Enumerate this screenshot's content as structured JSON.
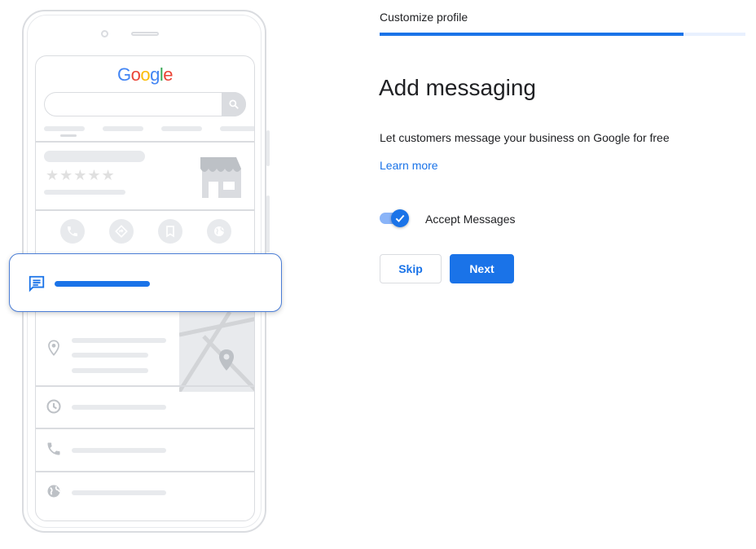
{
  "illustration": {
    "logo_letters": [
      "G",
      "o",
      "o",
      "g",
      "l",
      "e"
    ],
    "logo_colors": [
      "#4285f4",
      "#ea4335",
      "#fbbc05",
      "#4285f4",
      "#34a853",
      "#ea4335"
    ],
    "stars": "★★★★★"
  },
  "panel": {
    "step_title": "Customize profile",
    "progress_percent": 83,
    "heading": "Add messaging",
    "description": "Let customers message your business on Google for free",
    "learn_more": "Learn more",
    "toggle_label": "Accept Messages",
    "toggle_on": true,
    "skip_label": "Skip",
    "next_label": "Next"
  },
  "colors": {
    "accent": "#1a73e8",
    "placeholder_gray": "#e8eaed"
  }
}
